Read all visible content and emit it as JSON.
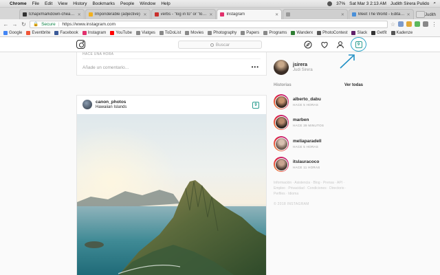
{
  "menubar": {
    "items": [
      "Chrome",
      "File",
      "Edit",
      "View",
      "History",
      "Bookmarks",
      "People",
      "Window",
      "Help"
    ],
    "battery": "37%",
    "clock": "Sat Mar 3  2:13 AM",
    "user": "Judith Sirera Pulido"
  },
  "tabs": [
    {
      "title": "tchapi/markdown-cheatsheet",
      "color": "#333333"
    },
    {
      "title": "Imponderable (adjective)",
      "color": "#f2b01e"
    },
    {
      "title": "verbs - \"log in to\" or \"log into\"",
      "color": "#c9302c"
    },
    {
      "title": "Instagram",
      "color": "#e1306c"
    },
    {
      "title": "",
      "color": "#999999"
    },
    {
      "title": "Meet The World - Editar elem",
      "color": "#4a90d9"
    }
  ],
  "profile_name": "Judith",
  "address": {
    "secure_label": "Secure",
    "url": "https://www.instagram.com"
  },
  "bookmarks": [
    {
      "label": "Google",
      "color": "#4285f4"
    },
    {
      "label": "Eventbrite",
      "color": "#f05537"
    },
    {
      "label": "Facebook",
      "color": "#3b5998"
    },
    {
      "label": "Instagram",
      "color": "#e1306c"
    },
    {
      "label": "YouTube",
      "color": "#ff0000"
    },
    {
      "label": "Viatges",
      "color": "#888888"
    },
    {
      "label": "ToDoList",
      "color": "#888888"
    },
    {
      "label": "Movies",
      "color": "#888888"
    },
    {
      "label": "Photography",
      "color": "#888888"
    },
    {
      "label": "Papers",
      "color": "#888888"
    },
    {
      "label": "Programs",
      "color": "#888888"
    },
    {
      "label": "Wanderx",
      "color": "#2e7d32"
    },
    {
      "label": "PhotoContest",
      "color": "#555555"
    },
    {
      "label": "Slack",
      "color": "#611f69"
    },
    {
      "label": "Getfit",
      "color": "#333333"
    },
    {
      "label": "Kadenze",
      "color": "#555555"
    }
  ],
  "ig": {
    "search_placeholder": "Buscar",
    "ext_badge": "9",
    "top_card": {
      "ago": "HACE UNA HORA",
      "comment_placeholder": "Añade un comentario...",
      "more": "•••"
    },
    "post": {
      "username": "canon_photos",
      "location": "Hawaiian Islands"
    },
    "me": {
      "username": "jsirera",
      "full_name": "Judi Sirera"
    },
    "stories_label": "Historias",
    "see_all": "Ver todas",
    "stories": [
      {
        "name": "alberto_dabu",
        "time": "HACE 5 HORAS"
      },
      {
        "name": "marben",
        "time": "HACE 39 MINUTOS"
      },
      {
        "name": "meliaparadell",
        "time": "HACE 5 HORAS"
      },
      {
        "name": "itslauracoco",
        "time": "HACE 11 HORAS"
      }
    ],
    "footer_links": "Información · Asistencia · Blog · Prensa · API · Empleo · Privacidad · Condiciones · Directorio · Perfiles · Idioma",
    "copyright": "© 2018 INSTAGRAM"
  }
}
